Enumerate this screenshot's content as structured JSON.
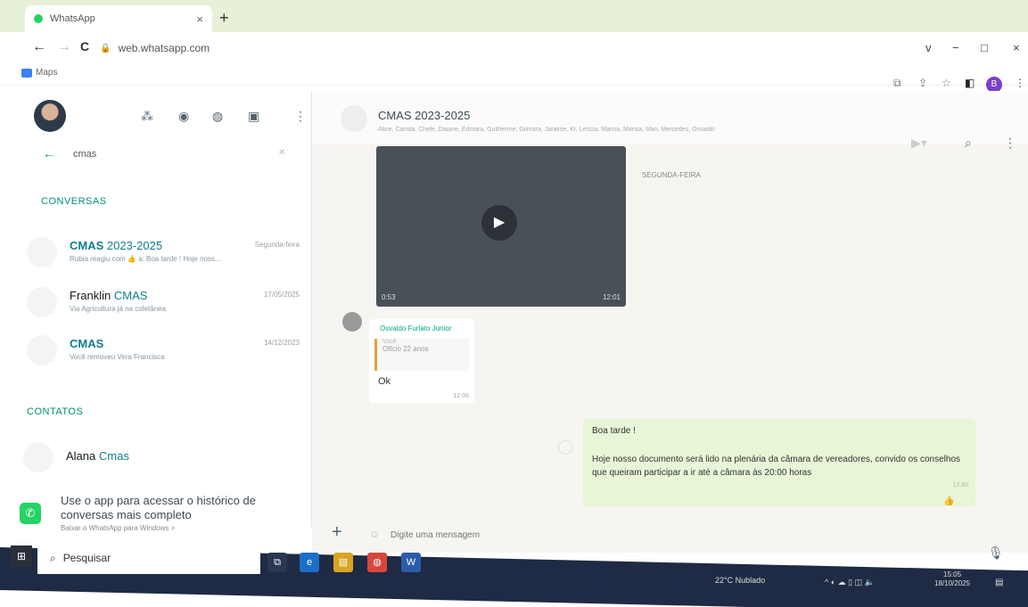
{
  "browser": {
    "tab_title": "WhatsApp",
    "tab_close": "×",
    "new_tab": "+",
    "back": "←",
    "forward": "→",
    "reload": "C",
    "url": "web.whatsapp.com",
    "bookmark": "Maps",
    "win_menu": "v",
    "win_min": "−",
    "win_max": "□",
    "win_close": "×",
    "profile_initial": "B"
  },
  "sidebar": {
    "search_value": "cmas",
    "search_clear": "✕",
    "section_chats": "CONVERSAS",
    "section_contacts": "CONTATOS",
    "chats": [
      {
        "name_plain": "",
        "name_match": "CMAS",
        "name_suffix": " 2023-2025",
        "preview": "Rubia reagiu com 👍 a: Boa tarde ! Hoje noss...",
        "time": "Segunda-feira"
      },
      {
        "name_plain": "Franklin ",
        "name_match": "CMAS",
        "name_suffix": "",
        "preview": "Via Agricultura já na coletânea",
        "time": "17/05/2025"
      },
      {
        "name_plain": "",
        "name_match": "CMAS",
        "name_suffix": "",
        "preview": "Você removeu Vera Francisca",
        "time": "14/12/2023"
      }
    ],
    "contacts": [
      {
        "name_plain": "Alana ",
        "name_match": "Cmas"
      }
    ],
    "promo_title": "Use o app para acessar o histórico de conversas mais completo",
    "promo_link": "Baixar o WhatsApp para Windows  >"
  },
  "chat": {
    "title": "CMAS 2023-2025",
    "members": "Aline, Camila, Chefe, Daiane, Edmara, Guilherme, Gilmara, Jaraline, Kr, Letícia, Márcia, Marisa, Mari, Mercedes, Osvaldo",
    "video_duration": "0:53",
    "video_time": "12:01",
    "date_chip": "SEGUNDA-FEIRA",
    "incoming": {
      "sender": "Osvaldo Furlato Junior",
      "quote_author": "Você",
      "quote_text": "Ofício 22 anos",
      "body": "Ok",
      "time": "12:06"
    },
    "outgoing": {
      "line1": "Boa tarde !",
      "line2": "Hoje nosso documento será lido na plenária da câmara de vereadores, convido os conselhos que queiram participar a ir até a câmara às 20:00 horas",
      "time": "12:40",
      "reaction": "👍"
    },
    "composer_placeholder": "Digite uma mensagem",
    "composer_plus": "+",
    "mic": "🎙"
  },
  "taskbar": {
    "search_label": "Pesquisar",
    "weather": "22°C  Nublado",
    "time": "15:05",
    "date": "18/10/2025"
  },
  "colors": {
    "accent": "#00a884",
    "match": "#0f7d8c",
    "outgoing_bubble": "#e8f5d6",
    "taskbar": "#1f2a44"
  },
  "icons": [
    "whatsapp-favicon",
    "lock-icon",
    "community-icon",
    "status-icon",
    "channels-icon",
    "new-chat-icon",
    "menu-icon",
    "search-icon",
    "video-call-icon",
    "play-icon",
    "mic-icon",
    "windows-start-icon"
  ]
}
